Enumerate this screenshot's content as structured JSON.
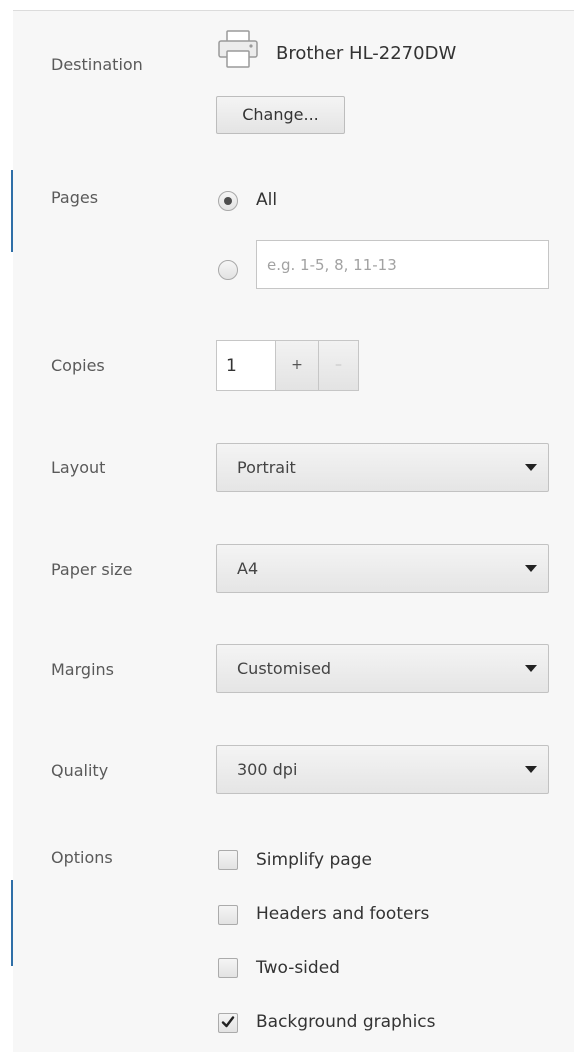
{
  "destination": {
    "label": "Destination",
    "printer_name": "Brother HL-2270DW",
    "printer_icon": "printer-icon",
    "change_button": "Change..."
  },
  "pages": {
    "label": "Pages",
    "options": [
      {
        "label": "All",
        "selected": true
      },
      {
        "label": "",
        "selected": false
      }
    ],
    "custom_placeholder": "e.g. 1-5, 8, 11-13",
    "custom_value": ""
  },
  "copies": {
    "label": "Copies",
    "value": "1",
    "increment_label": "+",
    "decrement_label": "–"
  },
  "layout": {
    "label": "Layout",
    "selected": "Portrait",
    "icon": "chevron-down-icon"
  },
  "paper_size": {
    "label": "Paper size",
    "selected": "A4",
    "icon": "chevron-down-icon"
  },
  "margins": {
    "label": "Margins",
    "selected": "Customised",
    "icon": "chevron-down-icon"
  },
  "quality": {
    "label": "Quality",
    "selected": "300 dpi",
    "icon": "chevron-down-icon"
  },
  "options": {
    "label": "Options",
    "items": [
      {
        "label": "Simplify page",
        "checked": false
      },
      {
        "label": "Headers and footers",
        "checked": false
      },
      {
        "label": "Two-sided",
        "checked": false
      },
      {
        "label": "Background graphics",
        "checked": true
      }
    ]
  },
  "colors": {
    "panel_background": "#f7f7f7",
    "edge_accent": "#2f6fa7",
    "text": "#333333",
    "label_text": "#5a5a5a"
  }
}
